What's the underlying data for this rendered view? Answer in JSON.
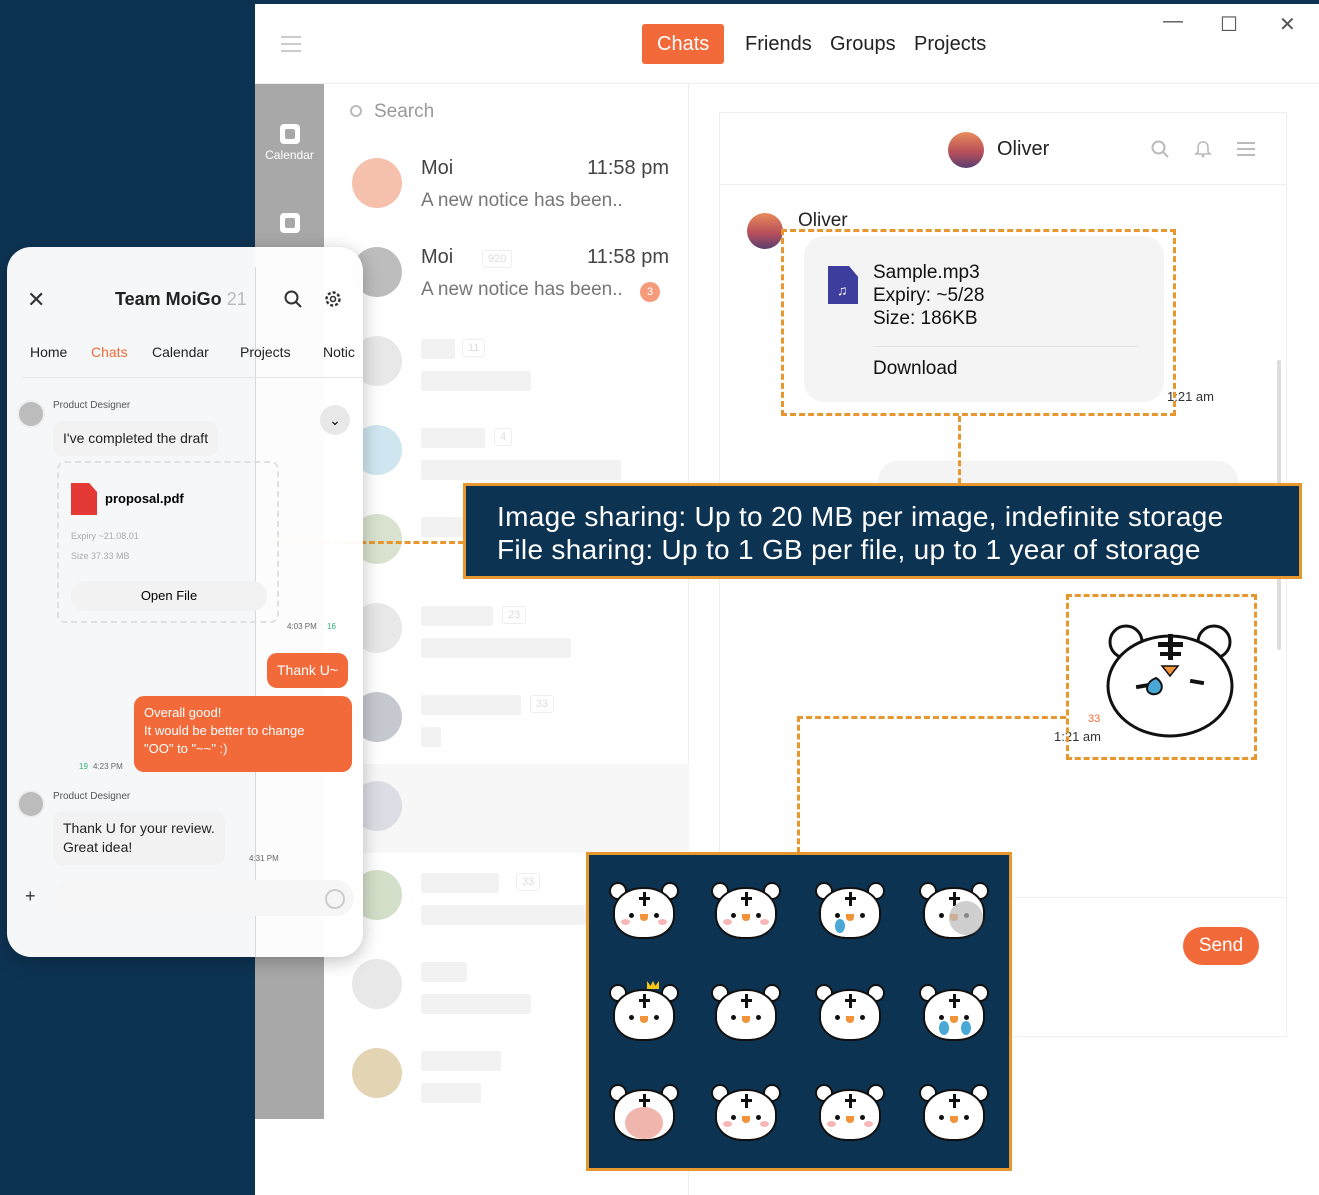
{
  "window": {
    "nav_tabs": [
      "Chats",
      "Friends",
      "Groups",
      "Projects"
    ],
    "controls": [
      "—",
      "☐",
      "✕"
    ]
  },
  "rail": [
    {
      "label": "Calendar",
      "icon": "calendar-icon"
    },
    {
      "label": "",
      "icon": "note-icon"
    }
  ],
  "chat_list": {
    "search_placeholder": "Search",
    "rows": [
      {
        "name": "Moi",
        "time": "11:58 pm",
        "preview": "A new notice has been..",
        "badge": ""
      },
      {
        "name": "Moi",
        "member_count": "920",
        "time": "11:58 pm",
        "preview": "A new notice has been..",
        "badge": "3"
      }
    ],
    "ghost_counts": [
      "11",
      "4",
      "23",
      "33",
      "33"
    ]
  },
  "chat": {
    "header_name": "Oliver",
    "sender": "Oliver",
    "file": {
      "name": "Sample.mp3",
      "expiry": "Expiry: ~5/28",
      "size": "Size: 186KB",
      "action": "Download",
      "time": "1:21 am"
    },
    "sticker_unread": "33",
    "sticker_time": "1:21 am",
    "send_label": "Send"
  },
  "banner": {
    "line1": "Image sharing: Up to 20 MB per image, indefinite storage",
    "line2": "File sharing: Up to 1 GB per file, up to 1 year of storage"
  },
  "mobile": {
    "title": "Team MoiGo",
    "member_count": "21",
    "tabs": [
      "Home",
      "Chats",
      "Calendar",
      "Projects",
      "Notic"
    ],
    "messages": {
      "role1": "Product Designer",
      "msg1": "I've completed the draft",
      "file_name": "proposal.pdf",
      "file_expiry": "Expiry  ~21.08.01",
      "file_size": "Size  37.33 MB",
      "open_label": "Open File",
      "time1": "4:03 PM",
      "read1": "16",
      "me1": "Thank U~",
      "me2": "Overall good!\nIt would be better to change\n\"OO\" to \"~~\" :)",
      "time2": "4:23 PM",
      "read2": "19",
      "role2": "Product Designer",
      "msg2": "Thank U for your review.\nGreat idea!",
      "time3": "4:31 PM"
    }
  },
  "colors": {
    "accent": "#f26a3a",
    "navy": "#0d3353",
    "dash": "#e8962e"
  }
}
